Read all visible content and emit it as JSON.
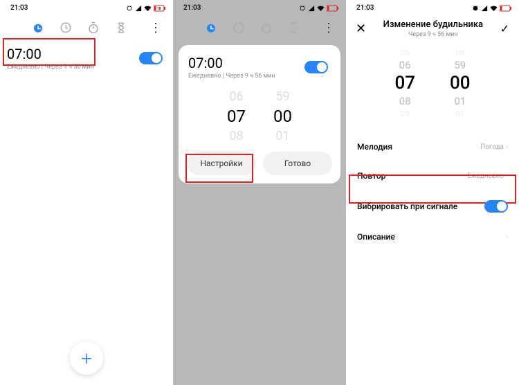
{
  "status": {
    "time": "21:03",
    "battery": "18"
  },
  "screen1": {
    "alarm_time": "07:00",
    "alarm_sub": "Ежедневно  |  Через 9 ч 56 мин"
  },
  "screen2": {
    "alarm_time": "07:00",
    "alarm_sub": "Ежедневно  |  Через 9 ч 56 мин",
    "picker_h": [
      "06",
      "07",
      "08"
    ],
    "picker_m": [
      "59",
      "00",
      "01"
    ],
    "btn_settings": "Настройки",
    "btn_done": "Готово"
  },
  "screen3": {
    "title": "Изменение будильника",
    "subtitle": "Через 9 ч 56 мин",
    "picker_h": [
      "05",
      "06",
      "07",
      "08",
      "09"
    ],
    "picker_m": [
      "58",
      "59",
      "00",
      "01",
      "02"
    ],
    "rows": {
      "melody_label": "Мелодия",
      "melody_value": "Погода",
      "repeat_label": "Повтор",
      "repeat_value": "Ежедневно",
      "vibrate_label": "Вибрировать при сигнале",
      "desc_label": "Описание"
    }
  }
}
